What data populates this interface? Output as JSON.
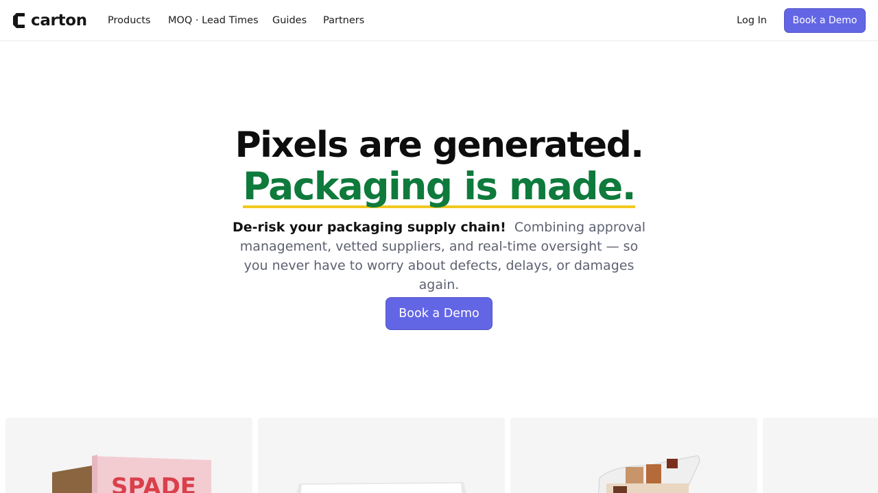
{
  "brand": {
    "name": "carton"
  },
  "nav": {
    "items": [
      {
        "label": "Products"
      },
      {
        "label": "MOQ · Lead Times"
      },
      {
        "label": "Guides"
      },
      {
        "label": "Partners"
      }
    ],
    "login_label": "Log In",
    "demo_label": "Book a Demo"
  },
  "hero": {
    "title_line1": "Pixels are generated.",
    "title_line2": "Packaging is made.",
    "subtitle_bold": "De-risk your packaging supply chain!",
    "subtitle_rest": "Combining approval management, vetted suppliers, and real-time oversight — so you never have to worry about defects, delays, or damages again.",
    "cta_label": "Book a Demo"
  },
  "products": {
    "box_print": "SPADE"
  },
  "colors": {
    "accent": "#6366e4",
    "headline_green": "#0e7a3c",
    "underline_yellow": "#f2c81e"
  }
}
